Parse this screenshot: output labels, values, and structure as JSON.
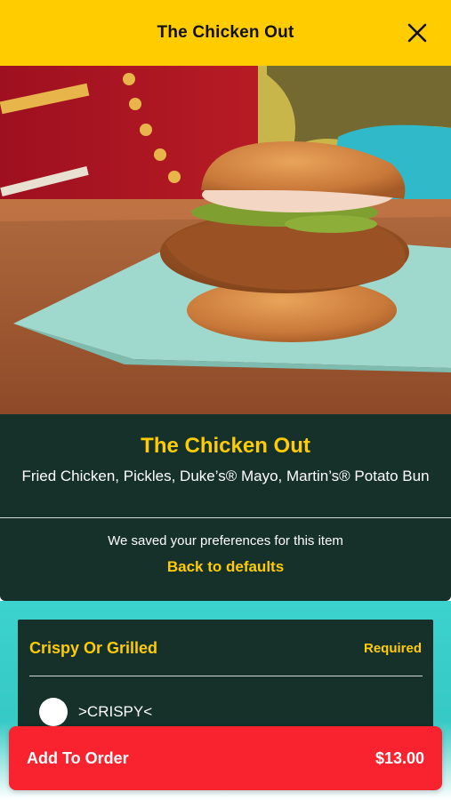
{
  "header": {
    "title": "The Chicken Out",
    "close_icon": "close-icon"
  },
  "hero": {
    "image": "fried-chicken-sandwich-photo"
  },
  "item": {
    "title": "The Chicken Out",
    "description": "Fried Chicken, Pickles, Duke’s® Mayo, Martin’s® Potato Bun",
    "preferences_note": "We saved your preferences for this item",
    "back_to_defaults": "Back to defaults"
  },
  "options": {
    "group_title": "Crispy Or Grilled",
    "required_label": "Required",
    "choices": [
      {
        "label": ">CRISPY<"
      }
    ]
  },
  "cta": {
    "label": "Add To Order",
    "price": "$13.00"
  },
  "colors": {
    "brand_yellow": "#ffcc00",
    "dark_green": "#16302a",
    "teal": "#3cd2cd",
    "cta_red": "#f8232e"
  }
}
